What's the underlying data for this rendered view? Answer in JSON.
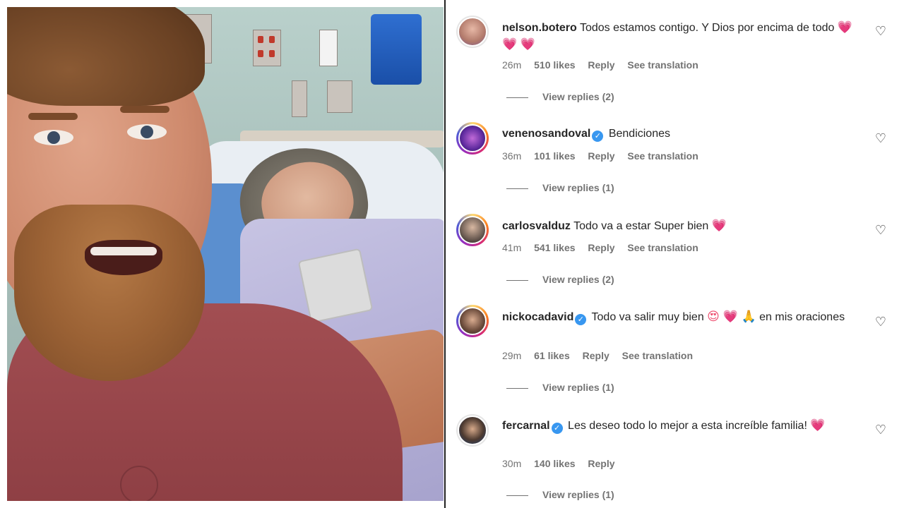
{
  "comments": [
    {
      "username": "nelson.botero",
      "verified": false,
      "text": "Todos estamos contigo. Y Dios por encima de todo",
      "emojis": "💗 💗 💗",
      "time": "26m",
      "likes": "510 likes",
      "reply": "Reply",
      "translation": "See translation",
      "view_replies": "View replies (2)"
    },
    {
      "username": "venenosandoval",
      "verified": true,
      "text": "Bendiciones",
      "emojis": "",
      "time": "36m",
      "likes": "101 likes",
      "reply": "Reply",
      "translation": "See translation",
      "view_replies": "View replies (1)"
    },
    {
      "username": "carlosvalduz",
      "verified": false,
      "text": "Todo va a estar Super bien",
      "emojis": "💗",
      "time": "41m",
      "likes": "541 likes",
      "reply": "Reply",
      "translation": "See translation",
      "view_replies": "View replies (2)"
    },
    {
      "username": "nickocadavid",
      "verified": true,
      "text": "Todo va salir muy bien",
      "emojis": "😍 💗 🙏",
      "text2": "en mis oraciones",
      "time": "29m",
      "likes": "61 likes",
      "reply": "Reply",
      "translation": "See translation",
      "view_replies": "View replies (1)"
    },
    {
      "username": "fercarnal",
      "verified": true,
      "text": "Les deseo todo lo mejor a esta increíble familia!",
      "emojis": "💗",
      "time": "30m",
      "likes": "140 likes",
      "reply": "Reply",
      "translation": "",
      "view_replies": "View replies (1)"
    }
  ],
  "icons": {
    "like": "heart-outline-icon",
    "verified": "verified-badge-icon"
  },
  "colors": {
    "meta_text": "#737373",
    "text": "#262626",
    "verified": "#3897f0",
    "heart": "#ed4a6c"
  }
}
